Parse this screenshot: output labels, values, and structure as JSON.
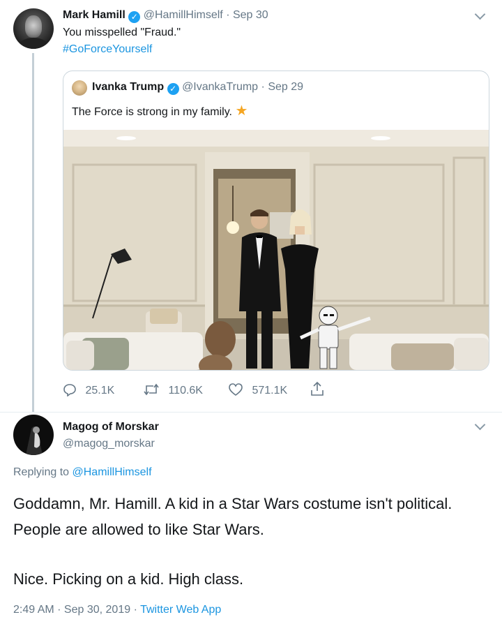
{
  "tweet1": {
    "author_name": "Mark Hamill",
    "handle": "@HamillHimself",
    "separator": "·",
    "date": "Sep 30",
    "text": "You misspelled \"Fraud.\"",
    "hashtag": "#GoForceYourself"
  },
  "quoted": {
    "author_name": "Ivanka Trump",
    "handle": "@IvankaTrump",
    "separator": "·",
    "date": "Sep 29",
    "text": "The Force is strong in my family.",
    "emoji": "★",
    "actions": {
      "replies": "25.1K",
      "retweets": "110.6K",
      "likes": "571.1K"
    }
  },
  "reply": {
    "author_name": "Magog of Morskar",
    "handle": "@magog_morskar",
    "replying_prefix": "Replying to",
    "replying_handle": "@HamillHimself",
    "paragraph1": "Goddamn, Mr. Hamill. A kid in a Star Wars costume isn't political. People are allowed to like Star Wars.",
    "paragraph2": "Nice. Picking on a kid. High class.",
    "timestamp": "2:49 AM · Sep 30, 2019",
    "separator": "·",
    "client": "Twitter Web App"
  },
  "colors": {
    "link": "#1b95e0",
    "verified": "#1da1f2",
    "muted": "#657786"
  },
  "icons": [
    "verified-badge-icon",
    "chevron-down-icon",
    "reply-icon",
    "retweet-icon",
    "like-icon",
    "share-icon",
    "star-emoji"
  ]
}
